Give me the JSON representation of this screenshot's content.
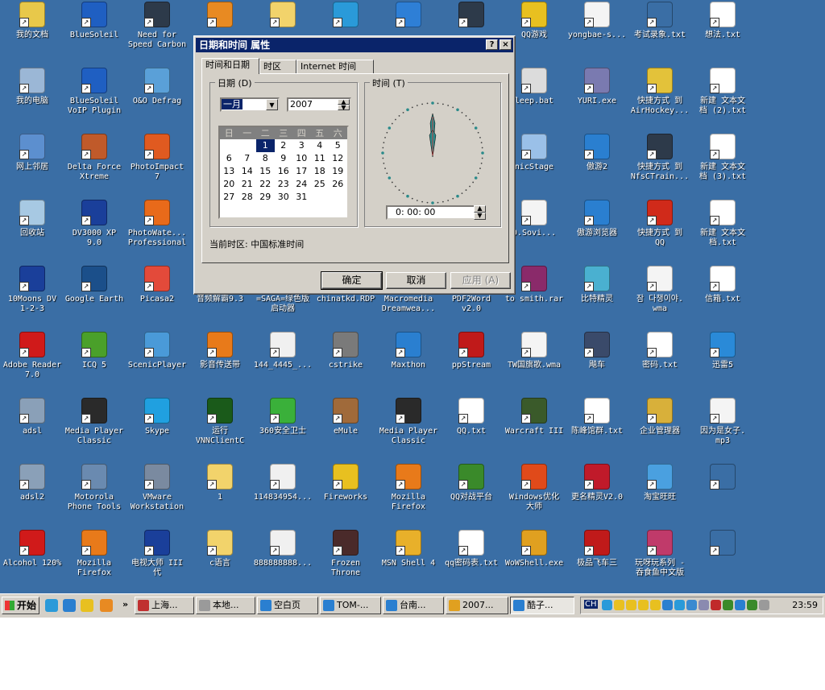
{
  "desktop": {
    "icons": [
      {
        "label": "我的文档",
        "color": "#e8c84a"
      },
      {
        "label": "BlueSoleil",
        "color": "#1f5fc2"
      },
      {
        "label": "Need for\nSpeed Carbon",
        "color": "#2d3a4a"
      },
      {
        "label": "",
        "color": "#e88a22"
      },
      {
        "label": "",
        "color": "#f2d36b"
      },
      {
        "label": "",
        "color": "#2a9ad9"
      },
      {
        "label": "",
        "color": "#2e7fd6"
      },
      {
        "label": "",
        "color": "#2d3a4a"
      },
      {
        "label": "QQ游戏",
        "color": "#e8c020"
      },
      {
        "label": "yongbae-s...",
        "color": "#f4f4f4"
      },
      {
        "label": "考试录象.txt",
        "color": "#3a6ea5"
      },
      {
        "label": "想法.txt",
        "color": "#ffffff"
      },
      {
        "label": "我的电脑",
        "color": "#9bb7d6"
      },
      {
        "label": "BlueSoleil\nVoIP Plugin",
        "color": "#1f5fc2"
      },
      {
        "label": "O&O Defrag",
        "color": "#5aa0d8"
      },
      {
        "label": "",
        "color": "#3a6ea5"
      },
      {
        "label": "",
        "color": "#3a6ea5"
      },
      {
        "label": "",
        "color": "#3a6ea5"
      },
      {
        "label": "",
        "color": "#3a6ea5"
      },
      {
        "label": "",
        "color": "#3a6ea5"
      },
      {
        "label": "leep.bat",
        "color": "#dcdcdc"
      },
      {
        "label": "YURI.exe",
        "color": "#7a7ab0"
      },
      {
        "label": "快捷方式 到\nAirHockey...",
        "color": "#e3c23a"
      },
      {
        "label": "新建 文本文\n档 (2).txt",
        "color": "#ffffff"
      },
      {
        "label": "网上邻居",
        "color": "#5c8fcf"
      },
      {
        "label": "Delta Force\nXtreme",
        "color": "#c05a2a"
      },
      {
        "label": "PhotoImpact\n7",
        "color": "#e05a20"
      },
      {
        "label": "",
        "color": "#3a6ea5"
      },
      {
        "label": "",
        "color": "#3a6ea5"
      },
      {
        "label": "",
        "color": "#3a6ea5"
      },
      {
        "label": "",
        "color": "#3a6ea5"
      },
      {
        "label": "",
        "color": "#3a6ea5"
      },
      {
        "label": "nicStage",
        "color": "#9ac0e8"
      },
      {
        "label": "傲游2",
        "color": "#2a7fd0"
      },
      {
        "label": "快捷方式 到\nNfsCTrain...",
        "color": "#2d3a4a"
      },
      {
        "label": "新建 文本文\n档 (3).txt",
        "color": "#ffffff"
      },
      {
        "label": "回收站",
        "color": "#a7c9e3"
      },
      {
        "label": "DV3000 XP\n9.0",
        "color": "#1a3f9a"
      },
      {
        "label": "PhotoWate...\nProfessional",
        "color": "#e86a1a"
      },
      {
        "label": "",
        "color": "#3a6ea5"
      },
      {
        "label": "",
        "color": "#3a6ea5"
      },
      {
        "label": "",
        "color": "#3a6ea5"
      },
      {
        "label": "",
        "color": "#3a6ea5"
      },
      {
        "label": "",
        "color": "#3a6ea5"
      },
      {
        "label": "0.Sovi...",
        "color": "#f4f4f4"
      },
      {
        "label": "傲游浏览器",
        "color": "#2a7fd0"
      },
      {
        "label": "快捷方式 到\nQQ",
        "color": "#d02a1a"
      },
      {
        "label": "新建 文本文\n档.txt",
        "color": "#ffffff"
      },
      {
        "label": "10Moons DV\n1-2-3",
        "color": "#1a3f9a"
      },
      {
        "label": "Google Earth",
        "color": "#1b4f8a"
      },
      {
        "label": "Picasa2",
        "color": "#e34a3a"
      },
      {
        "label": "音频解霸9.3",
        "color": "#3a6ea5"
      },
      {
        "label": "=SAGA=绿色版\n启动器",
        "color": "#3a6ea5"
      },
      {
        "label": "chinatkd.RDP",
        "color": "#3a6ea5"
      },
      {
        "label": "Macromedia\nDreamwea...",
        "color": "#3a6ea5"
      },
      {
        "label": "PDF2Word\nv2.0",
        "color": "#3a6ea5"
      },
      {
        "label": "to smith.rar",
        "color": "#8a2a6a"
      },
      {
        "label": "比特精灵",
        "color": "#4ab0d0"
      },
      {
        "label": "잠 다챙이야.\nwma",
        "color": "#f4f4f4"
      },
      {
        "label": "信箱.txt",
        "color": "#ffffff"
      },
      {
        "label": "Adobe Reader\n7.0",
        "color": "#d01a1a"
      },
      {
        "label": "ICQ 5",
        "color": "#4aa02a"
      },
      {
        "label": "ScenicPlayer",
        "color": "#4a9ad8"
      },
      {
        "label": "影音传送带",
        "color": "#e87a1a"
      },
      {
        "label": "144_4445_...",
        "color": "#f0f0f0"
      },
      {
        "label": "cstrike",
        "color": "#7a7a7a"
      },
      {
        "label": "Maxthon",
        "color": "#2a7fd0"
      },
      {
        "label": "ppStream",
        "color": "#c01a1a"
      },
      {
        "label": "TW国旗歌.wma",
        "color": "#f4f4f4"
      },
      {
        "label": "飚车",
        "color": "#3a4a6a"
      },
      {
        "label": "密码.txt",
        "color": "#ffffff"
      },
      {
        "label": "迅雷5",
        "color": "#2a8ad8"
      },
      {
        "label": "adsl",
        "color": "#8aa0b8"
      },
      {
        "label": "Media Player\nClassic",
        "color": "#2a2a2a"
      },
      {
        "label": "Skype",
        "color": "#20a0e0"
      },
      {
        "label": "运行\nVNNClientC",
        "color": "#1a5a1a"
      },
      {
        "label": "360安全卫士",
        "color": "#3ab03a"
      },
      {
        "label": "eMule",
        "color": "#a06a3a"
      },
      {
        "label": "Media Player\nClassic",
        "color": "#2a2a2a"
      },
      {
        "label": "QQ.txt",
        "color": "#ffffff"
      },
      {
        "label": "Warcraft III",
        "color": "#3a5a2a"
      },
      {
        "label": "陈峰馆群.txt",
        "color": "#ffffff"
      },
      {
        "label": "企业管理器",
        "color": "#d8b03a"
      },
      {
        "label": "因为是女子.\nmp3",
        "color": "#f4f4f4"
      },
      {
        "label": "adsl2",
        "color": "#8aa0b8"
      },
      {
        "label": "Motorola\nPhone Tools",
        "color": "#6a8ab0"
      },
      {
        "label": "VMware\nWorkstation",
        "color": "#7a8aa0"
      },
      {
        "label": "1",
        "color": "#f2d36b"
      },
      {
        "label": "114834954...",
        "color": "#f0f0f0"
      },
      {
        "label": "Fireworks",
        "color": "#e8c020"
      },
      {
        "label": "Mozilla\nFirefox",
        "color": "#e87a1a"
      },
      {
        "label": "QQ对战平台",
        "color": "#3a8a2a"
      },
      {
        "label": "Windows优化\n大师",
        "color": "#e04a1a"
      },
      {
        "label": "更名精灵V2.0",
        "color": "#c01a2a"
      },
      {
        "label": "淘宝旺旺",
        "color": "#4aa0e0"
      },
      {
        "label": "",
        "color": "#3a6ea5"
      },
      {
        "label": "Alcohol 120%",
        "color": "#d01a1a"
      },
      {
        "label": "Mozilla\nFirefox",
        "color": "#e87a1a"
      },
      {
        "label": "电视大师 III\n代",
        "color": "#1a3f9a"
      },
      {
        "label": "c语言",
        "color": "#f2d36b"
      },
      {
        "label": "888888888...",
        "color": "#f0f0f0"
      },
      {
        "label": "Frozen\nThrone",
        "color": "#4a2a2a"
      },
      {
        "label": "MSN Shell 4",
        "color": "#e8b02a"
      },
      {
        "label": "qq密码表.txt",
        "color": "#ffffff"
      },
      {
        "label": "WoWShell.exe",
        "color": "#e0a020"
      },
      {
        "label": "极品飞车三",
        "color": "#c01a1a"
      },
      {
        "label": "玩呀玩系列 -\n吞食鱼中文版",
        "color": "#c03a6a"
      },
      {
        "label": "",
        "color": "#3a6ea5"
      }
    ]
  },
  "dialog": {
    "title": "日期和时间 属性",
    "help_btn": "?",
    "close_btn": "×",
    "tabs": [
      "时间和日期",
      "时区",
      "Internet 时间"
    ],
    "date_group": "日期 (D)",
    "month": "一月",
    "year": "2007",
    "weekdays": [
      "日",
      "一",
      "二",
      "三",
      "四",
      "五",
      "六"
    ],
    "days": [
      "",
      "",
      "1",
      "2",
      "3",
      "4",
      "5",
      "6",
      "7",
      "8",
      "9",
      "10",
      "11",
      "12",
      "13",
      "14",
      "15",
      "16",
      "17",
      "18",
      "19",
      "20",
      "21",
      "22",
      "23",
      "24",
      "25",
      "26",
      "27",
      "28",
      "29",
      "30",
      "31",
      "",
      "",
      ""
    ],
    "today": "1",
    "time_group": "时间 (T)",
    "time_value": "0: 00: 00",
    "timezone_label": "当前时区: 中国标准时间",
    "ok": "确定",
    "cancel": "取消",
    "apply": "应用 (A)"
  },
  "taskbar": {
    "start": "开始",
    "chevron": "»",
    "tasks": [
      {
        "label": "上海...",
        "color": "#c03030"
      },
      {
        "label": "本地...",
        "color": "#9a9a9a"
      },
      {
        "label": "空白页",
        "color": "#2a7fd0"
      },
      {
        "label": "TOM-...",
        "color": "#2a7fd0"
      },
      {
        "label": "台南...",
        "color": "#2a7fd0"
      },
      {
        "label": "2007...",
        "color": "#e0a020"
      },
      {
        "label": "酷子...",
        "color": "#2a7fd0"
      }
    ],
    "lang": "CH",
    "clock": "23:59"
  }
}
